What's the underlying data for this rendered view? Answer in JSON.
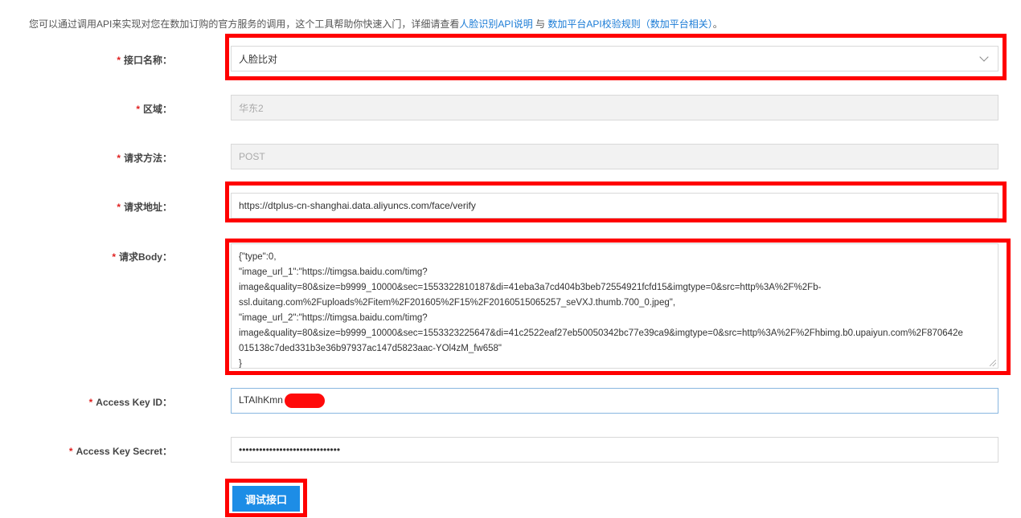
{
  "intro": {
    "text": "您可以通过调用API来实现对您在数加订购的官方服务的调用，这个工具帮助你快速入门，详细请查看",
    "link1": "人脸识别API说明",
    "and": "与",
    "link2": "数加平台API校验规则（数加平台相关）",
    "end": "。"
  },
  "form": {
    "required_mark": "*",
    "api_name": {
      "label": "接口名称：",
      "value": "人脸比对"
    },
    "region": {
      "label": "区域：",
      "value": "华东2"
    },
    "method": {
      "label": "请求方法：",
      "value": "POST"
    },
    "url": {
      "label": "请求地址：",
      "value": "https://dtplus-cn-shanghai.data.aliyuncs.com/face/verify"
    },
    "body": {
      "label": "请求Body：",
      "lines": [
        "{\"type\":0,",
        "\"image_url_1\":\"https://timgsa.baidu.com/timg?",
        "image&quality=80&size=b9999_10000&sec=1553322810187&di=41eba3a7cd404b3beb72554921fcfd15&imgtype=0&src=http%3A%2F%2Fb-",
        "ssl.duitang.com%2Fuploads%2Fitem%2F201605%2F15%2F20160515065257_seVXJ.thumb.700_0.jpeg\",",
        "\"image_url_2\":\"https://timgsa.baidu.com/timg?",
        "image&quality=80&size=b9999_10000&sec=1553323225647&di=41c2522eaf27eb50050342bc77e39ca9&imgtype=0&src=http%3A%2F%2Fhbimg.b0.upaiyun.com%2F870642e",
        "015138c7ded331b3e36b97937ac147d5823aac-YOl4zM_fw658\"",
        "}"
      ]
    },
    "access_key_id": {
      "label": "Access Key ID：",
      "value": "LTAIhKmn"
    },
    "access_key_secret": {
      "label": "Access Key Secret：",
      "value": "••••••••••••••••••••••••••••••"
    },
    "submit_label": "调试接口"
  },
  "colors": {
    "highlight": "#ff0000",
    "primary": "#1d8de6",
    "link": "#1a7bd6",
    "required": "#e02020"
  }
}
